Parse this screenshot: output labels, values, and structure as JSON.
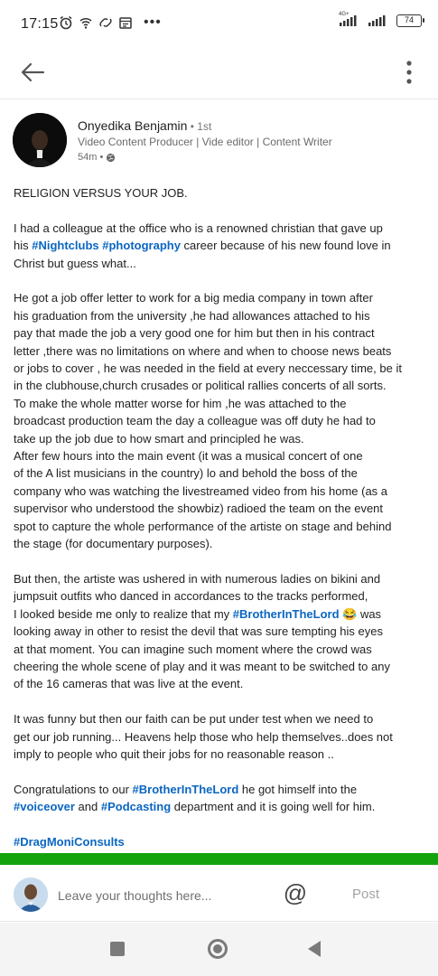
{
  "status_bar": {
    "time": "17:15",
    "network_tag": "4G+",
    "battery": "74"
  },
  "icons": {
    "back": "arrow-left-icon",
    "more": "kebab-menu-icon",
    "globe": "globe-icon",
    "mention": "at-sign-icon"
  },
  "author": {
    "name": "Onyedika Benjamin",
    "degree": " • 1st",
    "headline": "Video Content Producer | Vide editor | Content Writer",
    "time": "54m •"
  },
  "post": {
    "p1": "RELIGION VERSUS YOUR JOB.",
    "p2": [
      "I had a colleague at the office who is a renowned christian that gave up",
      [
        "his ",
        "#Nightclubs",
        "  ",
        "#photography",
        " career because of his new found love in"
      ],
      "Christ but guess what..."
    ],
    "p3": [
      "He got a job offer letter to work for a big media company in town after",
      "his graduation from the university ,he had allowances attached to his",
      "pay that made the job a very good one for him but then in his contract",
      "letter ,there was no limitations on where and when to choose news beats",
      "or jobs to cover , he was needed in the field at every neccessary time, be it",
      "in the clubhouse,church crusades or political rallies concerts of all sorts.",
      "To make the whole matter worse for him ,he was attached  to the",
      "broadcast production team the day a colleague was off duty he had to",
      "take up the job due to how smart and principled he was.",
      "After few hours into the main event (it was a musical concert of one",
      "of the A list musicians in the country) lo and behold the boss of the",
      "company who was watching the livestreamed video from his home (as a",
      "supervisor who understood the showbiz) radioed the team on the event",
      "spot to capture the whole performance of the artiste on stage and behind",
      "the stage (for documentary purposes)."
    ],
    "p4": [
      "But then, the artiste was ushered in with numerous ladies on bikini and",
      "jumpsuit outfits who danced in accordances to the tracks performed,",
      [
        "I looked beside me only to realize that my ",
        "#BrotherInTheLord",
        " 😂 was"
      ],
      "looking away in other to resist the devil that was sure tempting his eyes",
      "at that moment. You can imagine such moment where the crowd was",
      "cheering the whole scene of play and it was meant to be switched to any",
      "of the 16 cameras that was live at the event."
    ],
    "p5": [
      "It was funny but then our faith can be put under test when we need to",
      "get our job running... Heavens help those who help themselves..does not",
      "imply to people who quit their jobs for no reasonable reason .."
    ],
    "p6": [
      [
        "Congratulations to our ",
        "#BrotherInTheLord",
        " he got himself into the"
      ],
      [
        "",
        "#voiceover",
        "  and ",
        "#Podcasting",
        " department and it is going well for him."
      ]
    ],
    "p7": "#DragMoniConsults"
  },
  "comment": {
    "placeholder": "Leave your thoughts here...",
    "mention": "@",
    "post_label": "Post"
  },
  "colors": {
    "link": "#0a66c2",
    "divider_green": "#14a30d"
  }
}
